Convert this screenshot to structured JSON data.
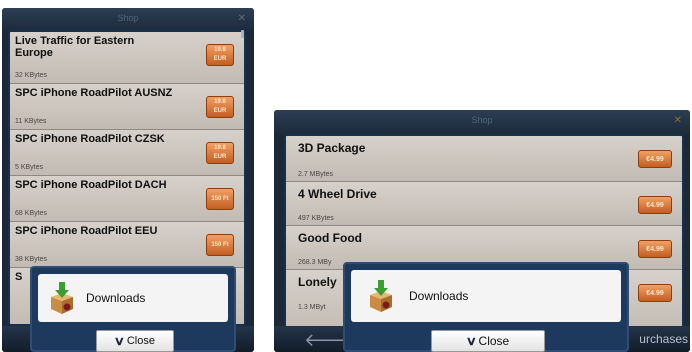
{
  "left": {
    "title": "Shop",
    "items": [
      {
        "name": "Live Traffic for Eastern Europe",
        "size": "32 KBytes",
        "price": [
          "19.8",
          "EUR"
        ]
      },
      {
        "name": "SPC iPhone RoadPilot AUSNZ",
        "size": "11 KBytes",
        "price": [
          "19.8",
          "EUR"
        ]
      },
      {
        "name": "SPC iPhone RoadPilot CZSK",
        "size": "5 KBytes",
        "price": [
          "19.8",
          "EUR"
        ]
      },
      {
        "name": "SPC iPhone RoadPilot DACH",
        "size": "68 KBytes",
        "price": [
          "150 Ft"
        ]
      },
      {
        "name": "SPC iPhone RoadPilot EEU",
        "size": "38 KBytes",
        "price": [
          "150 Ft"
        ]
      },
      {
        "name": "S",
        "size": "",
        "price": []
      }
    ],
    "dialog": {
      "label": "Downloads",
      "close": "Close"
    }
  },
  "right": {
    "title": "Shop",
    "items": [
      {
        "name": "3D Package",
        "size": "2.7 MBytes",
        "price": "€4.99"
      },
      {
        "name": "4 Wheel Drive",
        "size": "497 KBytes",
        "price": "€4.99"
      },
      {
        "name": "Good Food",
        "size": "268.3 MBy",
        "price": "€4.99"
      },
      {
        "name": "Lonely",
        "size": "1.3 MByt",
        "price": "€4.99"
      }
    ],
    "dialog": {
      "label": "Downloads",
      "close": "Close"
    },
    "bottom": {
      "purchases": "urchases"
    }
  },
  "colors": {
    "price_button": "#d87a3a",
    "dialog_border": "#2f4d72",
    "list_bg": "#c9c3bb"
  },
  "icons": {
    "back": "left-arrow-icon",
    "download": "download-box-icon",
    "close_chevron": "chevron-down-icon"
  }
}
